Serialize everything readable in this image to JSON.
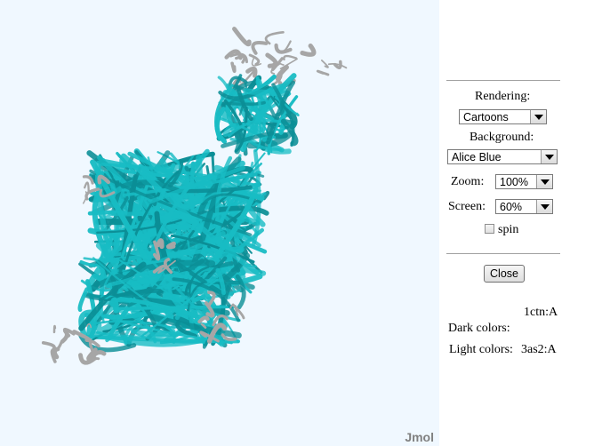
{
  "viewer": {
    "brand": "Jmol",
    "background_color": "#f0f8ff",
    "ribbon_color": "#18bcc4",
    "ribbon_dark": "#0b8e96",
    "coil_color": "#a6a6a6"
  },
  "panel": {
    "rendering_label": "Rendering:",
    "rendering_value": "Cartoons",
    "background_label": "Background:",
    "background_value": "Alice Blue",
    "zoom_label": "Zoom:",
    "zoom_value": "100%",
    "screen_label": "Screen:",
    "screen_value": "60%",
    "spin_label": "spin",
    "spin_checked": false,
    "close_label": "Close",
    "dark_value": "1ctn:A",
    "dark_label": "Dark colors:",
    "light_label": "Light colors:",
    "light_value": "3as2:A"
  }
}
